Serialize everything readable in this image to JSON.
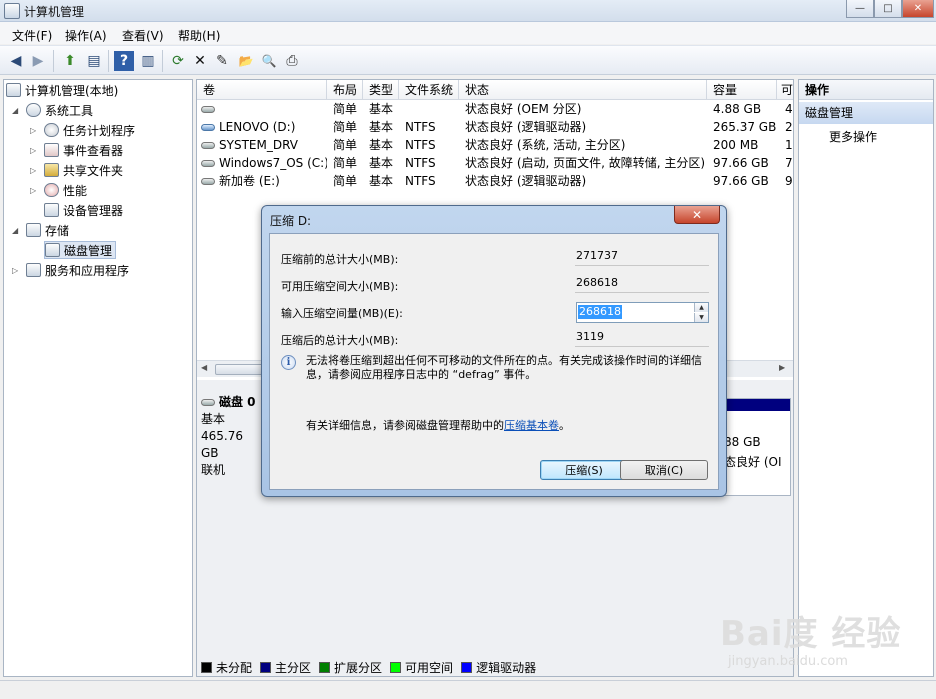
{
  "window": {
    "title": "计算机管理",
    "minimize": "—",
    "maximize": "□",
    "close": "✕"
  },
  "menu": [
    "文件(F)",
    "操作(A)",
    "查看(V)",
    "帮助(H)"
  ],
  "toolbar": {
    "back": "◀",
    "forward": "▶",
    "up": "⬆",
    "showhide": "▤",
    "help": "?",
    "props": "▥",
    "refresh": "⟳",
    "delete": "✕",
    "properties": "✎",
    "open": "📂",
    "find": "🔍",
    "export": "⎙"
  },
  "tree": {
    "root": "计算机管理(本地)",
    "system_tools": "系统工具",
    "task_scheduler": "任务计划程序",
    "event_viewer": "事件查看器",
    "shared_folders": "共享文件夹",
    "performance": "性能",
    "device_manager": "设备管理器",
    "storage": "存储",
    "disk_management": "磁盘管理",
    "services": "服务和应用程序"
  },
  "volumes": {
    "columns": [
      "卷",
      "布局",
      "类型",
      "文件系统",
      "状态",
      "容量",
      "可"
    ],
    "rows": [
      {
        "name": "",
        "layout": "简单",
        "type": "基本",
        "fs": "",
        "status": "状态良好 (OEM 分区)",
        "capacity": "4.88 GB",
        "free": "4"
      },
      {
        "name": "LENOVO (D:)",
        "layout": "简单",
        "type": "基本",
        "fs": "NTFS",
        "status": "状态良好 (逻辑驱动器)",
        "capacity": "265.37 GB",
        "free": "2"
      },
      {
        "name": "SYSTEM_DRV",
        "layout": "简单",
        "type": "基本",
        "fs": "NTFS",
        "status": "状态良好 (系统, 活动, 主分区)",
        "capacity": "200 MB",
        "free": "1"
      },
      {
        "name": "Windows7_OS (C:)",
        "layout": "简单",
        "type": "基本",
        "fs": "NTFS",
        "status": "状态良好 (启动, 页面文件, 故障转储, 主分区)",
        "capacity": "97.66 GB",
        "free": "7"
      },
      {
        "name": "新加卷 (E:)",
        "layout": "简单",
        "type": "基本",
        "fs": "NTFS",
        "status": "状态良好 (逻辑驱动器)",
        "capacity": "97.66 GB",
        "free": "9"
      }
    ]
  },
  "disk": {
    "name": "磁盘 0",
    "type": "基本",
    "size": "465.76 GB",
    "state": "联机",
    "right_size": "88 GB",
    "right_status": "态良好 (OI"
  },
  "legend": [
    {
      "label": "未分配",
      "color": "#000000"
    },
    {
      "label": "主分区",
      "color": "#00007f"
    },
    {
      "label": "扩展分区",
      "color": "#007f00"
    },
    {
      "label": "可用空间",
      "color": "#00ff00"
    },
    {
      "label": "逻辑驱动器",
      "color": "#0000ff"
    }
  ],
  "actions": {
    "header": "操作",
    "selected": "磁盘管理",
    "more": "更多操作",
    "more_arrow": "▶"
  },
  "dialog": {
    "title": "压缩 D:",
    "close": "✕",
    "fields": [
      {
        "label": "压缩前的总计大小(MB):",
        "value": "271737"
      },
      {
        "label": "可用压缩空间大小(MB):",
        "value": "268618"
      },
      {
        "label": "输入压缩空间量(MB)(E):",
        "value": "268618"
      },
      {
        "label": "压缩后的总计大小(MB):",
        "value": "3119"
      }
    ],
    "info_text": "无法将卷压缩到超出任何不可移动的文件所在的点。有关完成该操作时间的详细信息，请参阅应用程序日志中的 “defrag” 事件。",
    "help_prefix": "有关详细信息，请参阅磁盘管理帮助中的",
    "help_link": "压缩基本卷",
    "help_suffix": "。",
    "shrink_button": "压缩(S)",
    "cancel_button": "取消(C)"
  },
  "watermark": {
    "logo": "Bai度 经验",
    "url": "jingyan.baidu.com"
  }
}
